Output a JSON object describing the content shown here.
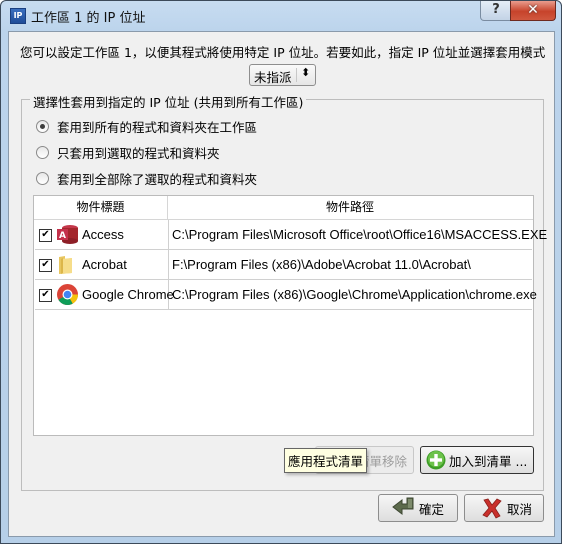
{
  "window": {
    "icon_label": "IP",
    "title": "工作區 1 的 IP 位址",
    "help_glyph": "?",
    "close_glyph": "✕"
  },
  "description": "您可以設定工作區 1，以便其程式將使用特定 IP 位址。若要如此，指定 IP 位址並選擇套用模式",
  "mode_select": {
    "value": "未指派",
    "arrow_glyph": "⬍"
  },
  "group": {
    "legend": "選擇性套用到指定的 IP 位址 (共用到所有工作區)",
    "radios": [
      {
        "label": "套用到所有的程式和資料夾在工作區",
        "checked": true
      },
      {
        "label": "只套用到選取的程式和資料夾",
        "checked": false
      },
      {
        "label": "套用到全部除了選取的程式和資料夾",
        "checked": false
      }
    ]
  },
  "table": {
    "columns": [
      "物件標題",
      "物件路徑"
    ],
    "rows": [
      {
        "checked": true,
        "icon": "access-icon",
        "name": "Access",
        "path": "C:\\Program Files\\Microsoft Office\\root\\Office16\\MSACCESS.EXE"
      },
      {
        "checked": true,
        "icon": "folder-icon",
        "name": "Acrobat",
        "path": "F:\\Program Files (x86)\\Adobe\\Acrobat 11.0\\Acrobat\\"
      },
      {
        "checked": true,
        "icon": "chrome-icon",
        "name": "Google Chrome",
        "path": "C:\\Program Files (x86)\\Google\\Chrome\\Application\\chrome.exe"
      }
    ],
    "check_glyph": "✔"
  },
  "buttons": {
    "remove_label": "從清單移除",
    "add_label": "加入到清單 ...",
    "ok_label": "確定",
    "cancel_label": "取消"
  },
  "tooltip": "應用程式清單"
}
